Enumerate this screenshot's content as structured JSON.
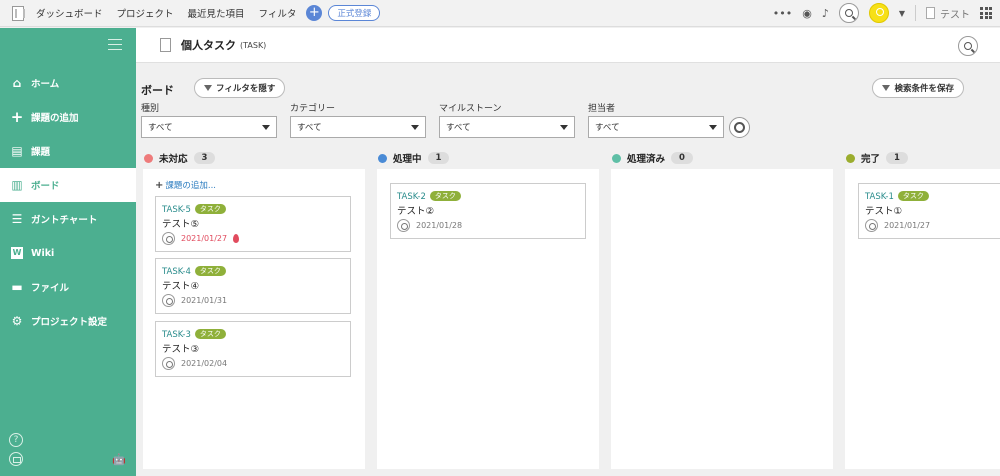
{
  "topbar": {
    "nav": [
      "ダッシュボード",
      "プロジェクト",
      "最近見た項目",
      "フィルタ"
    ],
    "register": "正式登録",
    "more": "•••",
    "project": "テスト"
  },
  "sidebar": {
    "items": [
      {
        "label": "ホーム",
        "icon": "home-icon",
        "glyph": "⌂"
      },
      {
        "label": "課題の追加",
        "icon": "plus-icon",
        "glyph": "+"
      },
      {
        "label": "課題",
        "icon": "list-icon",
        "glyph": "▤"
      },
      {
        "label": "ボード",
        "icon": "board-icon",
        "glyph": "▥"
      },
      {
        "label": "ガントチャート",
        "icon": "gantt-icon",
        "glyph": "☰"
      },
      {
        "label": "Wiki",
        "icon": "wiki-icon",
        "glyph": "W"
      },
      {
        "label": "ファイル",
        "icon": "file-icon",
        "glyph": "▬"
      },
      {
        "label": "プロジェクト設定",
        "icon": "gear-icon",
        "glyph": "⚙"
      }
    ],
    "help": "?",
    "apple": "",
    "android": "🤖"
  },
  "header": {
    "title": "個人タスク",
    "key": "(TASK)"
  },
  "board": {
    "title": "ボード",
    "hide_filter": "フィルタを隠す",
    "save_search": "検索条件を保存",
    "filters": [
      {
        "label": "種別",
        "value": "すべて"
      },
      {
        "label": "カテゴリー",
        "value": "すべて"
      },
      {
        "label": "マイルストーン",
        "value": "すべて"
      },
      {
        "label": "担当者",
        "value": "すべて"
      }
    ],
    "add_task": "課題の追加...",
    "columns": [
      {
        "name": "未対応",
        "count": "3",
        "color": "#ee7b7b"
      },
      {
        "name": "処理中",
        "count": "1",
        "color": "#4a8bd6"
      },
      {
        "name": "処理済み",
        "count": "0",
        "color": "#5fbfa6"
      },
      {
        "name": "完了",
        "count": "1",
        "color": "#9bad2e"
      }
    ],
    "tag": "タスク",
    "cards": {
      "task5": {
        "key": "TASK-5",
        "title": "テスト⑤",
        "date": "2021/01/27"
      },
      "task4": {
        "key": "TASK-4",
        "title": "テスト④",
        "date": "2021/01/31"
      },
      "task3": {
        "key": "TASK-3",
        "title": "テスト③",
        "date": "2021/02/04"
      },
      "task2": {
        "key": "TASK-2",
        "title": "テスト②",
        "date": "2021/01/28"
      },
      "task1": {
        "key": "TASK-1",
        "title": "テスト①",
        "date": "2021/01/27"
      }
    }
  }
}
